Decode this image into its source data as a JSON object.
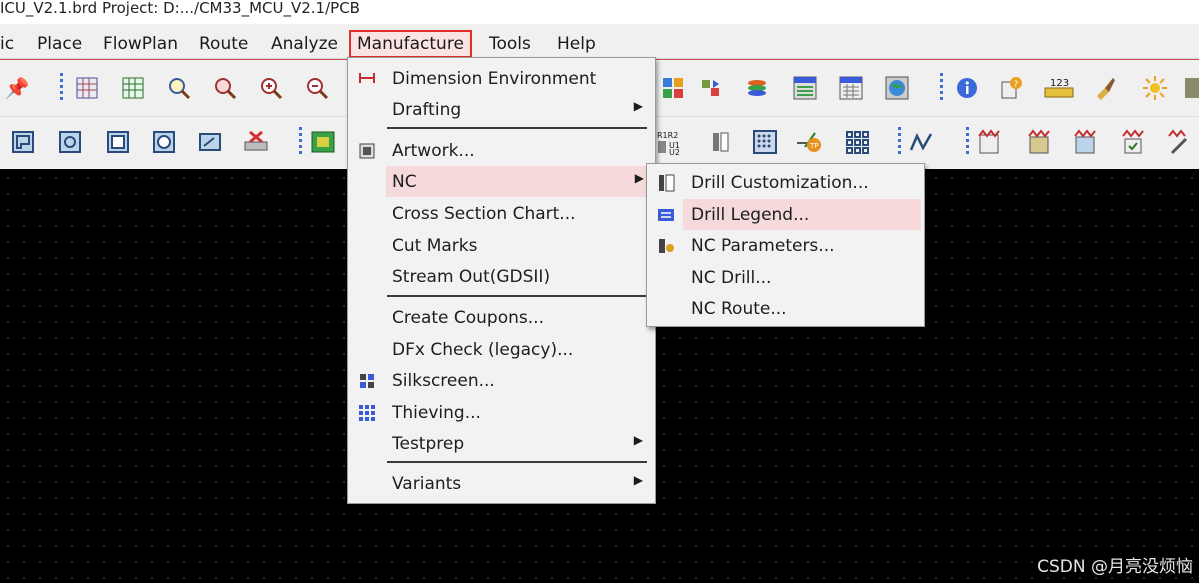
{
  "window": {
    "title": "ICU_V2.1.brd  Project: D:.../CM33_MCU_V2.1/PCB"
  },
  "menubar": {
    "items": [
      {
        "label": "ic"
      },
      {
        "label": "Place"
      },
      {
        "label": "FlowPlan"
      },
      {
        "label": "Route"
      },
      {
        "label": "Analyze"
      },
      {
        "label": "Manufacture"
      },
      {
        "label": "Tools"
      },
      {
        "label": "Help"
      }
    ],
    "active": "Manufacture"
  },
  "manufacture_menu": {
    "items": [
      {
        "label": "Dimension Environment",
        "icon": "dimension-icon"
      },
      {
        "label": "Drafting",
        "submenu": true
      },
      {
        "label": "Artwork...",
        "icon": "artwork-icon"
      },
      {
        "label": "NC",
        "submenu": true,
        "highlighted": true
      },
      {
        "label": "Cross Section Chart..."
      },
      {
        "label": "Cut Marks"
      },
      {
        "label": "Stream Out(GDSII)"
      },
      {
        "label": "Create Coupons..."
      },
      {
        "label": "DFx Check (legacy)..."
      },
      {
        "label": "Silkscreen...",
        "icon": "silkscreen-icon"
      },
      {
        "label": "Thieving...",
        "icon": "thieving-icon"
      },
      {
        "label": "Testprep",
        "submenu": true
      },
      {
        "label": "Variants",
        "submenu": true
      }
    ]
  },
  "nc_submenu": {
    "items": [
      {
        "label": "Drill Customization...",
        "icon": "drill-customization-icon"
      },
      {
        "label": "Drill Legend...",
        "icon": "drill-legend-icon",
        "highlighted": true
      },
      {
        "label": "NC Parameters...",
        "icon": "nc-parameters-icon"
      },
      {
        "label": "NC Drill..."
      },
      {
        "label": "NC Route..."
      }
    ]
  },
  "watermark": "CSDN @月亮没烦恼",
  "colors": {
    "highlight": "#f5d9db",
    "active_border": "#e0302a",
    "canvas": "#000000"
  }
}
